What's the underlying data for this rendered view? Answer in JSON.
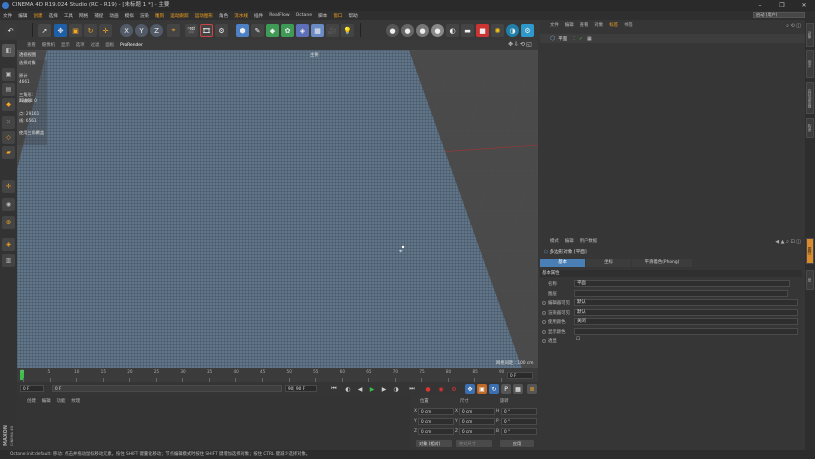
{
  "window": {
    "title": "CINEMA 4D R19.024 Studio (RC - R19) - [未标题 1 *] - 主要"
  },
  "menu": [
    "文件",
    "编辑",
    "创建",
    "选择",
    "工具",
    "网格",
    "捕捉",
    "动画",
    "模拟",
    "渲染",
    "雕刻",
    "运动跟踪",
    "运动图形",
    "角色",
    "流水线",
    "插件",
    "RealFlow",
    "Octane",
    "脚本",
    "窗口",
    "帮助"
  ],
  "menu_highlight": [
    "创建",
    "雕刻",
    "运动跟踪",
    "运动图形",
    "流水线",
    "窗口"
  ],
  "layout": {
    "label": "界面",
    "value": "启动 (用户)"
  },
  "toolbar_axis": [
    "X",
    "Y",
    "Z"
  ],
  "viewport_menu": [
    "查看",
    "摄像机",
    "显示",
    "选项",
    "过滤",
    "面板",
    "ProRender"
  ],
  "viewport": {
    "camera_label": "透视视图",
    "perspective_tag": "主要"
  },
  "info_overlay": [
    "选择对象",
    "",
    "原计",
    "4661",
    "",
    "三角形: 12800",
    "四边形: 0",
    "",
    "点: 29161",
    "线: 6561",
    "",
    "使用三角覆盖"
  ],
  "grid_spacing": "网格间距 : 100 cm",
  "timeline": {
    "ticks": [
      "0",
      "5",
      "10",
      "15",
      "20",
      "25",
      "30",
      "35",
      "40",
      "45",
      "50",
      "55",
      "60",
      "65",
      "70",
      "75",
      "80",
      "85",
      "90"
    ],
    "end_field": "0 F"
  },
  "transport": {
    "start": "0 F",
    "current": "0 F",
    "end": "90 F",
    "max": "90 F"
  },
  "bottom_tabs": [
    "创建",
    "编辑",
    "功能",
    "纹理"
  ],
  "coords": {
    "headers": [
      "位置",
      "尺寸",
      "旋转"
    ],
    "rows": [
      {
        "axis": "X",
        "pos": "0 cm",
        "size": "0 cm",
        "rot_label": "H",
        "rot": "0 °"
      },
      {
        "axis": "Y",
        "pos": "0 cm",
        "size": "0 cm",
        "rot_label": "P",
        "rot": "0 °"
      },
      {
        "axis": "Z",
        "pos": "0 cm",
        "size": "0 cm",
        "rot_label": "B",
        "rot": "0 °"
      }
    ],
    "mode": "对象 (相对)",
    "mode2": "绝对尺寸",
    "apply": "应用"
  },
  "status": "Octane:init:default: 移动: 点击并拖动鼠标移动元素。按住 SHIFT 键量化移动；节点编辑模式时按住 SHIFT 键增加选择对象；按住 CTRL 键减少选择对象。",
  "branding": {
    "maxon": "MAXON",
    "c4d": "CINEMA 4D"
  },
  "object_manager": {
    "tabs": [
      "文件",
      "编辑",
      "查看",
      "对象",
      "标签",
      "书签"
    ],
    "active_tab": "标签",
    "objects": [
      {
        "name": "平面"
      }
    ]
  },
  "right_strip": [
    "对象",
    "场次",
    "内容浏览器",
    "构造",
    "属性",
    "层"
  ],
  "attributes": {
    "tabs": [
      "模式",
      "编辑",
      "用户数据"
    ],
    "title": "多边形对象 [平面]",
    "subtabs": [
      "基本",
      "坐标",
      "平滑着色(Phong)"
    ],
    "active_subtab": "基本",
    "section": "基本属性",
    "rows": [
      {
        "label": "名称",
        "value": "平面"
      },
      {
        "label": "图层",
        "value": ""
      },
      {
        "label": "编辑器可见",
        "value": "默认"
      },
      {
        "label": "渲染器可见",
        "value": "默认"
      },
      {
        "label": "使用颜色",
        "value": "关闭"
      },
      {
        "label": "显示颜色",
        "value": ""
      },
      {
        "label": "透显",
        "value": "☐"
      }
    ]
  },
  "colors": {
    "accent": "#f5a623",
    "selection": "#4a7fb5",
    "grid_y": "#2e7d32",
    "grid_x": "#c62828",
    "mesh": "#5f7488"
  }
}
